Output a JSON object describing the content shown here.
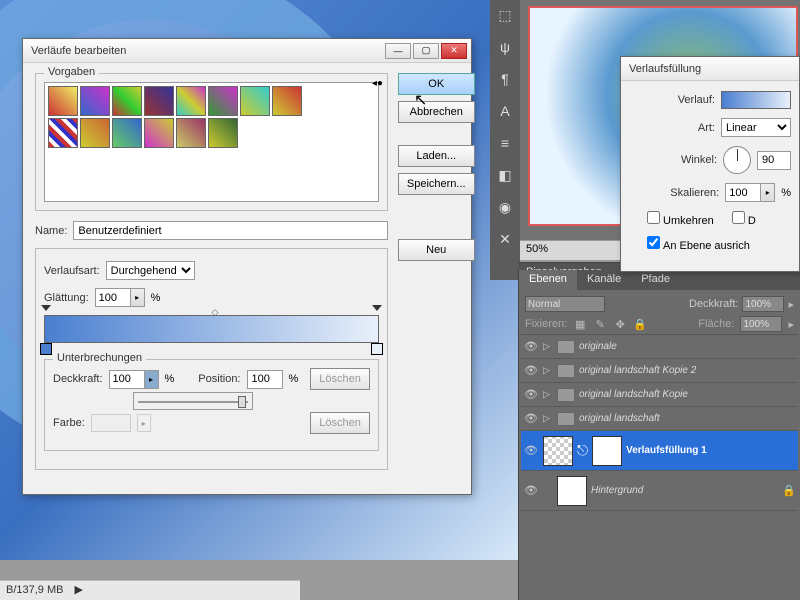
{
  "statusbar": {
    "memory": "B/137,9 MB"
  },
  "dialog": {
    "title": "Verläufe bearbeiten",
    "presets_legend": "Vorgaben",
    "name_label": "Name:",
    "name_value": "Benutzerdefiniert",
    "type_label": "Verlaufsart:",
    "type_value": "Durchgehend",
    "smooth_label": "Glättung:",
    "smooth_value": "100",
    "smooth_unit": "%",
    "stops_legend": "Unterbrechungen",
    "opacity_label": "Deckkraft:",
    "opacity_value": "100",
    "opacity_unit": "%",
    "position_label": "Position:",
    "position_value": "100",
    "position_unit": "%",
    "color_label": "Farbe:",
    "buttons": {
      "ok": "OK",
      "cancel": "Abbrechen",
      "load": "Laden...",
      "save": "Speichern...",
      "new": "Neu",
      "delete": "Löschen"
    }
  },
  "fill": {
    "title": "Verlaufsfüllung",
    "gradient_label": "Verlauf:",
    "style_label": "Art:",
    "style_value": "Linear",
    "angle_label": "Winkel:",
    "angle_value": "90",
    "scale_label": "Skalieren:",
    "scale_value": "100",
    "scale_unit": "%",
    "reverse_label": "Umkehren",
    "dither_label": "D",
    "align_label": "An Ebene ausrich"
  },
  "zoom": "50%",
  "pinsel_tab": "Pinselvorgaben",
  "layers_panel": {
    "tabs": [
      "Ebenen",
      "Kanäle",
      "Pfade"
    ],
    "blend_mode": "Normal",
    "opacity_label": "Deckkraft:",
    "opacity_value": "100%",
    "lock_label": "Fixieren:",
    "fill_label": "Fläche:",
    "fill_value": "100%",
    "layers": [
      {
        "name": "originale",
        "type": "folder"
      },
      {
        "name": "original landschaft Kopie 2",
        "type": "folder"
      },
      {
        "name": "original landschaft Kopie",
        "type": "folder"
      },
      {
        "name": "original landschaft",
        "type": "folder"
      },
      {
        "name": "Verlaufsfüllung 1",
        "type": "fill",
        "selected": true
      },
      {
        "name": "Hintergrund",
        "type": "bg",
        "locked": true
      }
    ]
  }
}
